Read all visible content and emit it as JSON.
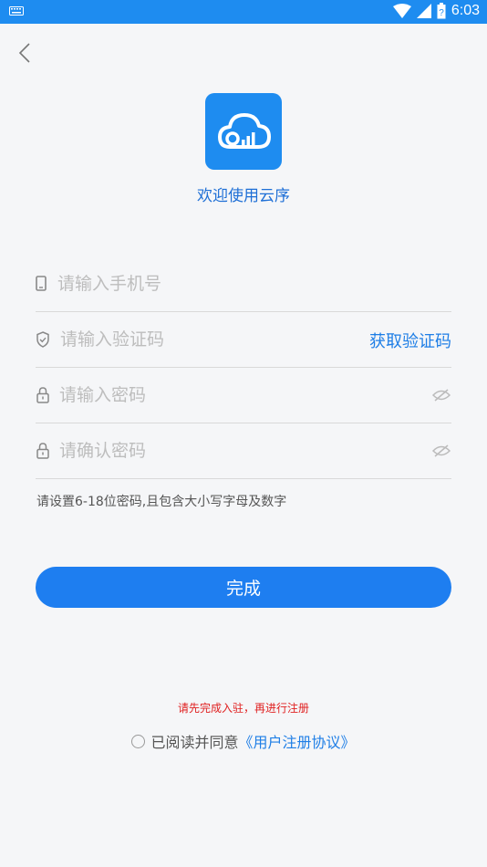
{
  "status_bar": {
    "time": "6:03",
    "icons": [
      "keyboard-icon",
      "wifi-icon",
      "signal-icon",
      "battery-icon"
    ]
  },
  "app": {
    "title": "欢迎使用云序",
    "brand_color": "#1e8cf0"
  },
  "form": {
    "phone": {
      "placeholder": "请输入手机号",
      "value": "",
      "icon": "phone-icon"
    },
    "code": {
      "placeholder": "请输入验证码",
      "value": "",
      "icon": "shield-icon",
      "get_code_label": "获取验证码"
    },
    "password": {
      "placeholder": "请输入密码",
      "value": "",
      "icon": "lock-icon",
      "toggle_icon": "eye-hidden-icon"
    },
    "confirm": {
      "placeholder": "请确认密码",
      "value": "",
      "icon": "lock-icon",
      "toggle_icon": "eye-hidden-icon"
    },
    "hint": "请设置6-18位密码,且包含大小写字母及数字"
  },
  "submit_label": "完成",
  "notice": "请先完成入驻，再进行注册",
  "agreement": {
    "prefix": "已阅读并同意",
    "link": "《用户注册协议》",
    "checked": false
  }
}
